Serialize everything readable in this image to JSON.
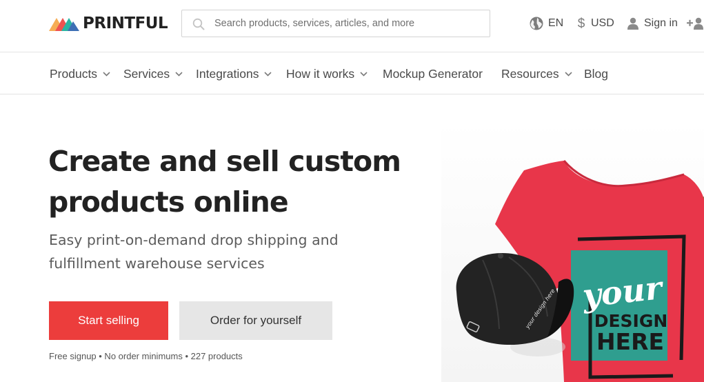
{
  "brand": {
    "name": "PRINTFUL"
  },
  "search": {
    "placeholder": "Search products, services, articles, and more"
  },
  "topbar": {
    "language": "EN",
    "currency": "USD",
    "sign_in": "Sign in"
  },
  "nav": {
    "items": [
      {
        "label": "Products"
      },
      {
        "label": "Services"
      },
      {
        "label": "Integrations"
      },
      {
        "label": "How it works"
      },
      {
        "label": "Mockup Generator"
      },
      {
        "label": "Resources"
      },
      {
        "label": "Blog"
      }
    ]
  },
  "hero": {
    "title_line1": "Create and sell custom",
    "title_line2": "products online",
    "subtitle_line1": "Easy print-on-demand drop shipping and",
    "subtitle_line2": "fulfillment warehouse services",
    "primary_button": "Start selling",
    "secondary_button": "Order for yourself",
    "fine_print": "Free signup • No order minimums • 227 products"
  },
  "image": {
    "design_word1": "your",
    "design_word2": "DESIGN",
    "design_word3": "HERE"
  },
  "colors": {
    "accent_red": "#ec3d3c",
    "tshirt_red": "#e8364a",
    "design_teal": "#2f9e8f"
  },
  "icons": [
    "search-icon",
    "globe-icon",
    "dollar-icon",
    "user-icon",
    "add-user-icon",
    "chevron-down-icon"
  ]
}
